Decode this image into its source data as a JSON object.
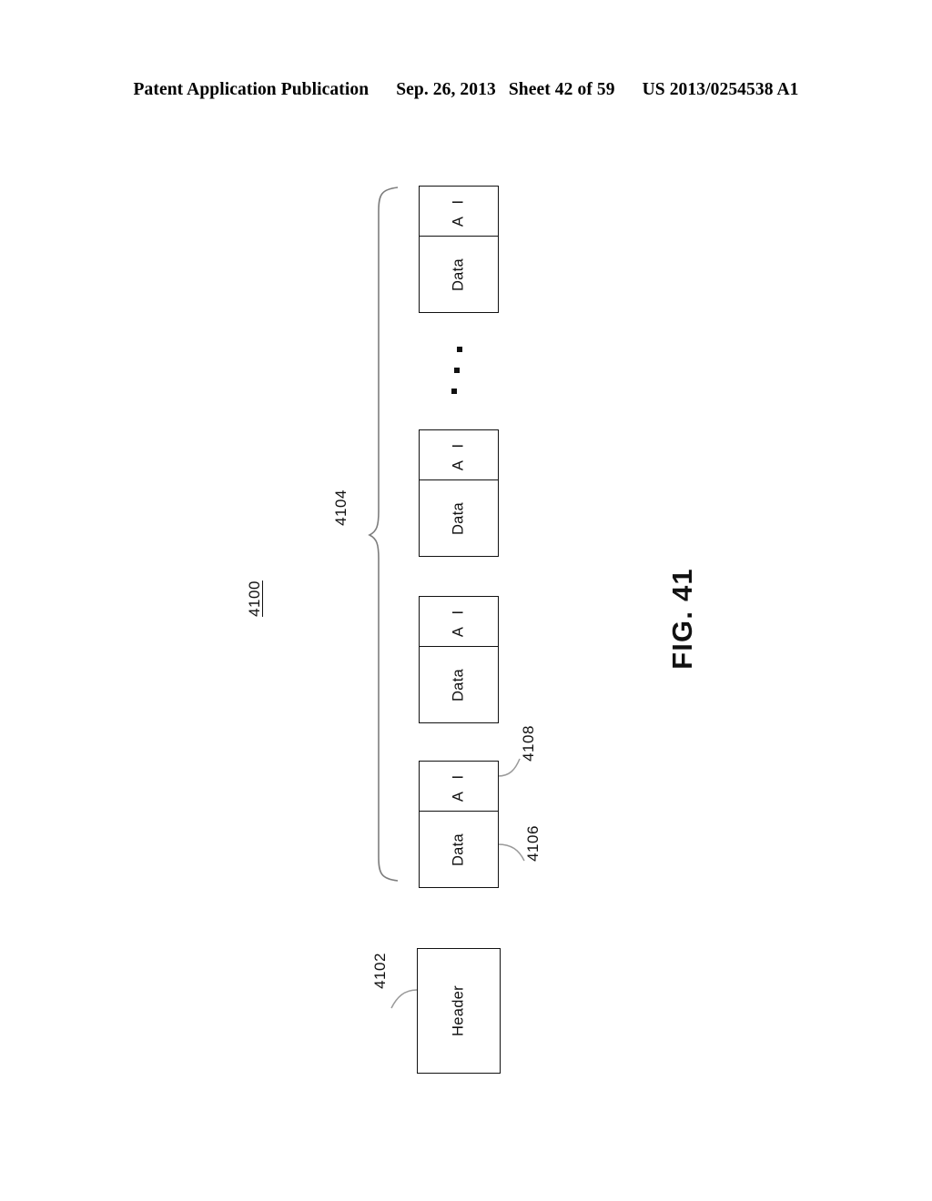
{
  "page_header": {
    "publication": "Patent Application Publication",
    "date": "Sep. 26, 2013",
    "sheet": "Sheet 42 of 59",
    "patent_number": "US 2013/0254538 A1"
  },
  "figure": {
    "title": "FIG. 41",
    "overall_ref": "4100",
    "header_block": {
      "label": "Header",
      "ref": "4102"
    },
    "group_ref": "4104",
    "data_cell_ref": "4106",
    "ai_cell_ref": "4108",
    "blocks": [
      {
        "ai_label": "A I",
        "data_label": "Data"
      },
      {
        "ai_label": "A I",
        "data_label": "Data"
      },
      {
        "ai_label": "A I",
        "data_label": "Data"
      },
      {
        "ai_label": "A I",
        "data_label": "Data"
      }
    ],
    "ellipsis": "· · ·",
    "line_color": "#111111",
    "background_color": "#ffffff"
  }
}
